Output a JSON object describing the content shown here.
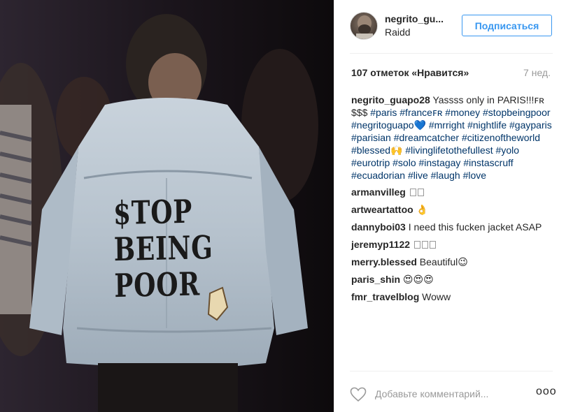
{
  "post": {
    "username": "negrito_gu...",
    "location": "Raidd",
    "follow_label": "Подписаться",
    "likes": "107 отметок «Нравится»",
    "time_ago": "7 нед.",
    "jacket_text": [
      "$TOP",
      "BEING",
      "POOR"
    ],
    "caption": {
      "user": "negrito_guapo28",
      "text": "Yassss only in PARIS!!!ꜰʀ $$$",
      "hashtags": "#paris #franceꜰʀ #money #stopbeingpoor #negritoguapo💙 #mrright #nightlife #gayparis #parisian #dreamcatcher #citizenoftheworld #blessed🙌 #livinglifetothefullest #yolo #eurotrip #solo #instagay #instascruff #ecuadorian #live #laugh #love"
    },
    "comments": [
      {
        "user": "armanvilleg",
        "text": ""
      },
      {
        "user": "artweartattoo",
        "text": "👌"
      },
      {
        "user": "dannyboi03",
        "text": "I need this fucken jacket ASAP"
      },
      {
        "user": "jeremyp1122",
        "text": ""
      },
      {
        "user": "merry.blessed",
        "text": "Beautiful😉"
      },
      {
        "user": "paris_shin",
        "text": "😍😍😍"
      },
      {
        "user": "fmr_travelblog",
        "text": "Woww"
      }
    ],
    "add_comment_placeholder": "Добавьте комментарий...",
    "more_label": "ooo"
  },
  "icons": {
    "heart": "heart-icon",
    "more": "more-options-icon",
    "avatar": "avatar"
  }
}
